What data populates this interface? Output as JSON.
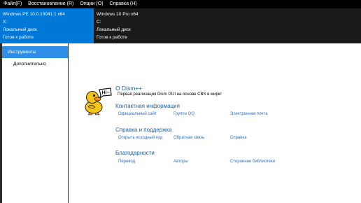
{
  "menu": [
    "Файл(F)",
    "Восстановление (R)",
    "Опции (O)",
    "Справка (H)"
  ],
  "sessions": [
    {
      "os": "Windows PE 10.0.19041.1 x64",
      "drive": "X:",
      "type": "Локальный диск",
      "status": "Готов к работе",
      "active": true
    },
    {
      "os": "Windows 10 Pro x64",
      "drive": "C:",
      "type": "Локальный диск",
      "status": "Готов к работе",
      "active": false
    }
  ],
  "sidebar": {
    "items": [
      {
        "label": "Инструменты",
        "selected": true
      },
      {
        "label": "Дополнительно",
        "selected": false
      }
    ]
  },
  "about": {
    "title": "О Dism++",
    "subtitle": "Первая реализация Dism GUI на основе CBS в мире!"
  },
  "contacts": {
    "title": "Контактная информация",
    "links": [
      "Официальный сайт",
      "Группа QQ",
      "Электронная почта"
    ]
  },
  "help": {
    "title": "Справка и поддержка",
    "links": [
      "Открыть исходный код",
      "Обратная связь",
      "Справка"
    ]
  },
  "thanks": {
    "title": "Благодарности",
    "links": [
      "Перевод",
      "Авторы",
      "Сторонние библиотеки"
    ]
  },
  "colors": {
    "accent": "#0078d7",
    "selected": "#2e8ee8",
    "heading": "#1e5fa8",
    "link": "#2a6fc4",
    "duck": "#f5c518"
  },
  "icons": {
    "logo": "duck-icon"
  },
  "logo_text": "Hi~"
}
